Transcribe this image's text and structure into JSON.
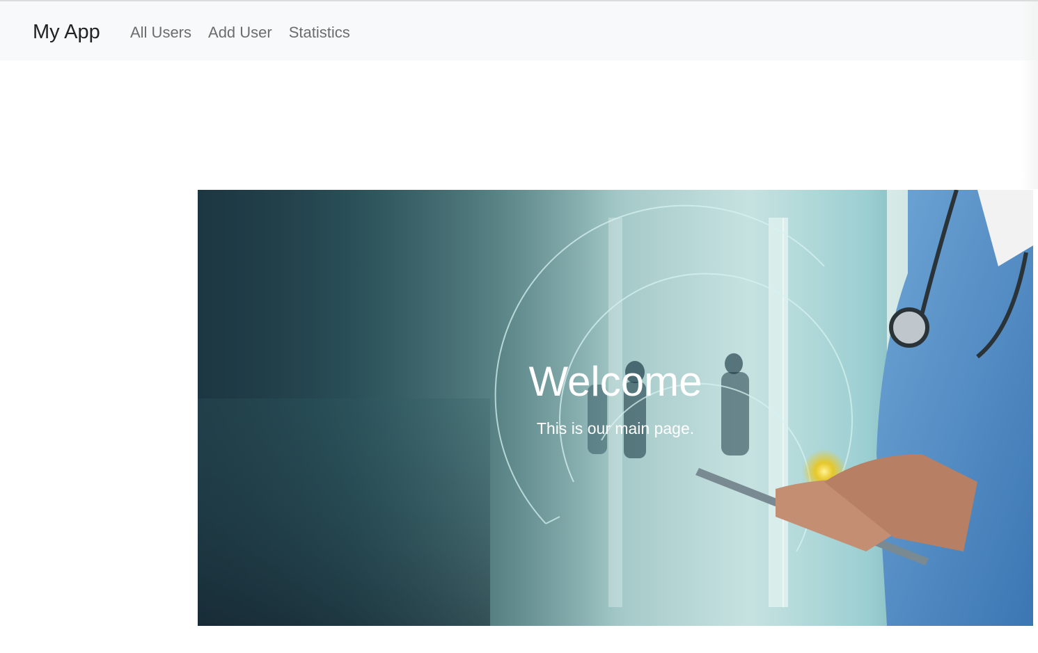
{
  "navbar": {
    "brand": "My App",
    "links": [
      {
        "label": "All Users"
      },
      {
        "label": "Add User"
      },
      {
        "label": "Statistics"
      }
    ],
    "background": "#f8f9fa"
  },
  "hero": {
    "title": "Welcome",
    "subtitle": "This is our main page.",
    "image_icon": "doctor-tablet-hospital-image"
  }
}
